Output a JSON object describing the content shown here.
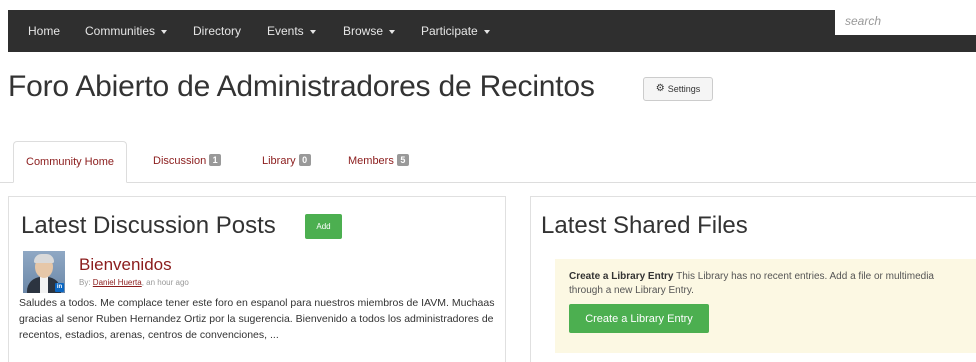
{
  "nav": {
    "items": [
      {
        "label": "Home",
        "dropdown": false
      },
      {
        "label": "Communities",
        "dropdown": true
      },
      {
        "label": "Directory",
        "dropdown": false
      },
      {
        "label": "Events",
        "dropdown": true
      },
      {
        "label": "Browse",
        "dropdown": true
      },
      {
        "label": "Participate",
        "dropdown": true
      }
    ],
    "search_placeholder": "search"
  },
  "page": {
    "title": "Foro Abierto de Administradores de Recintos",
    "settings_label": "Settings"
  },
  "tabs": [
    {
      "label": "Community Home",
      "badge": null,
      "active": true
    },
    {
      "label": "Discussion",
      "badge": "1",
      "active": false
    },
    {
      "label": "Library",
      "badge": "0",
      "active": false
    },
    {
      "label": "Members",
      "badge": "5",
      "active": false
    }
  ],
  "discussion": {
    "heading": "Latest Discussion Posts",
    "add_label": "Add",
    "post": {
      "title": "Bienvenidos",
      "by_label": "By:",
      "author": "Daniel Huerta",
      "time": ", an hour ago",
      "body": "Saludes a todos.  Me complace tener este foro en espanol para nuestros miembros de IAVM. Muchaas gracias al senor Ruben Hernandez Ortiz por la sugerencia.   Bienvenido a todos los administradores de recentos, estadios, arenas, centros de convenciones, ..."
    }
  },
  "files": {
    "heading": "Latest Shared Files",
    "notice_bold": "Create a Library Entry",
    "notice_text": " This Library has no recent entries. Add a file or multimedia through a new Library Entry.",
    "create_label": "Create a Library Entry"
  },
  "colors": {
    "nav_bg": "#2f2f2f",
    "link": "#8b1c1c",
    "green": "#4caf50",
    "notice_bg": "#fcf8e3",
    "badge": "#999999"
  },
  "icons": [
    "gear-icon",
    "caret-down-icon",
    "linkedin-icon"
  ]
}
